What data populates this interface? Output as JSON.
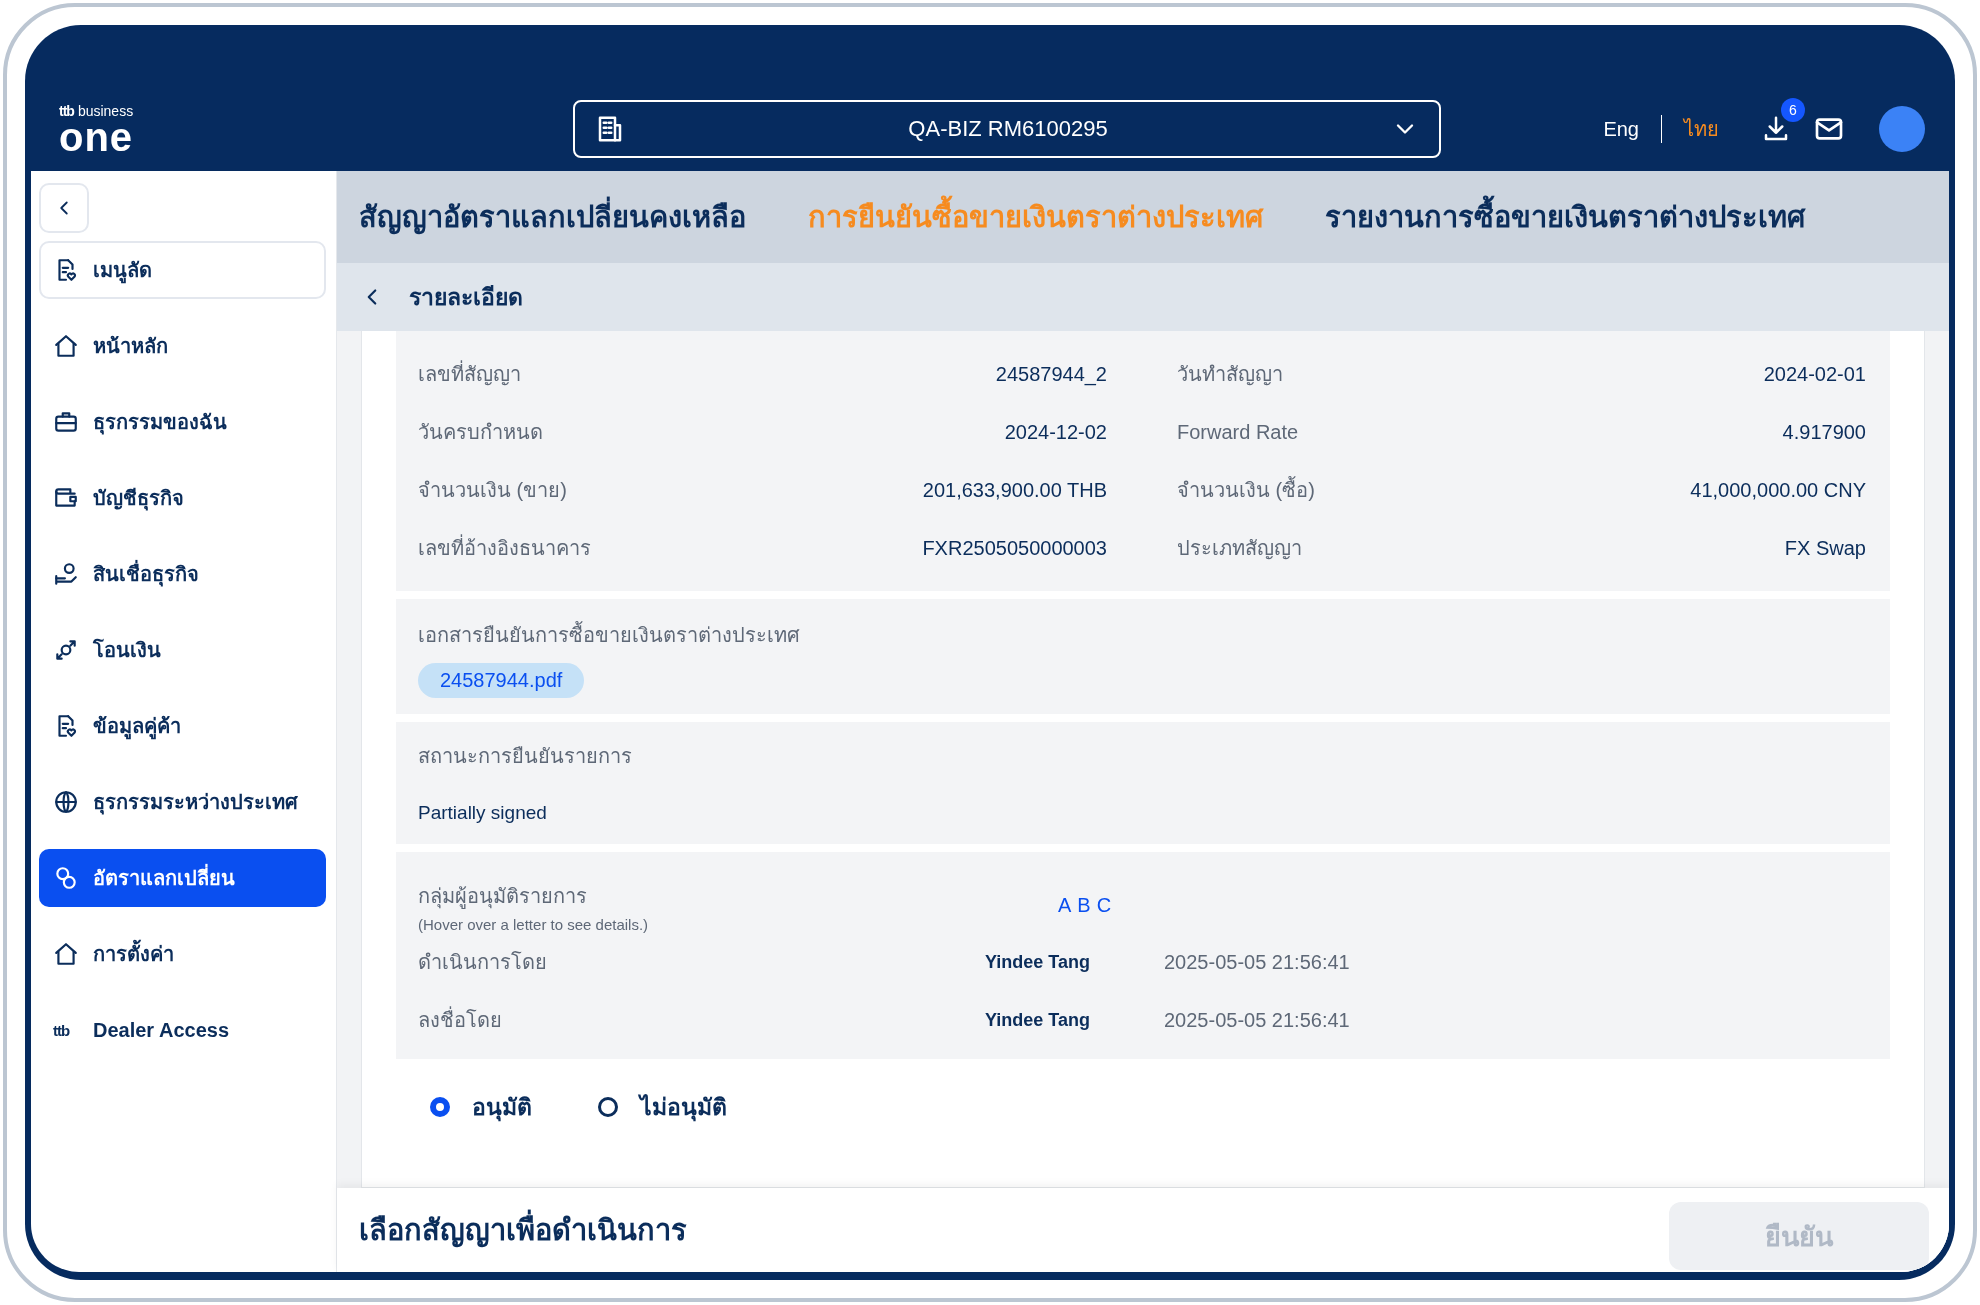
{
  "header": {
    "logo_small": "ttb",
    "logo_top": "business",
    "logo_main": "one",
    "account": "QA-BIZ RM6100295",
    "languages": [
      {
        "label": "Eng",
        "selected": false
      },
      {
        "label": "ไทย",
        "selected": true
      }
    ],
    "download_badge": "6"
  },
  "sidebar": {
    "items": [
      {
        "label": "เมนูลัด",
        "kind": "shortcut",
        "selected": false
      },
      {
        "label": "หน้าหลัก",
        "kind": "item",
        "selected": false
      },
      {
        "label": "ธุรกรรมของฉัน",
        "kind": "item",
        "selected": false
      },
      {
        "label": "บัญชีธุรกิจ",
        "kind": "item",
        "selected": false
      },
      {
        "label": "สินเชื่อธุรกิจ",
        "kind": "item",
        "selected": false
      },
      {
        "label": "โอนเงิน",
        "kind": "item",
        "selected": false
      },
      {
        "label": "ข้อมูลคู่ค้า",
        "kind": "item",
        "selected": false
      },
      {
        "label": "ธุรกรรมระหว่างประเทศ",
        "kind": "item",
        "selected": false
      },
      {
        "label": "อัตราแลกเปลี่ยน",
        "kind": "item",
        "selected": true
      },
      {
        "label": "การตั้งค่า",
        "kind": "item",
        "selected": false
      },
      {
        "label": "Dealer Access",
        "kind": "logo",
        "logo": "ttb",
        "selected": false
      }
    ]
  },
  "tabs": [
    {
      "label": "สัญญาอัตราแลกเปลี่ยนคงเหลือ",
      "selected": false
    },
    {
      "label": "การยืนยันซื้อขายเงินตราต่างประเทศ",
      "selected": true
    },
    {
      "label": "รายงานการซื้อขายเงินตราต่างประเทศ",
      "selected": false
    }
  ],
  "subheader": {
    "title": "รายละเอียด"
  },
  "details": [
    {
      "left_label": "เลขที่สัญญา",
      "left_value": "24587944_2",
      "right_label": "วันทำสัญญา",
      "right_value": "2024-02-01"
    },
    {
      "left_label": "วันครบกำหนด",
      "left_value": "2024-12-02",
      "right_label": "Forward Rate",
      "right_value": "4.917900"
    },
    {
      "left_label": "จำนวนเงิน (ขาย)",
      "left_value": "201,633,900.00 THB",
      "right_label": "จำนวนเงิน (ซื้อ)",
      "right_value": "41,000,000.00 CNY"
    },
    {
      "left_label": "เลขที่อ้างอิงธนาคาร",
      "left_value": "FXR2505050000003",
      "right_label": "ประเภทสัญญา",
      "right_value": "FX Swap"
    }
  ],
  "document": {
    "label": "เอกสารยืนยันการซื้อขายเงินตราต่างประเทศ",
    "file": "24587944.pdf"
  },
  "status": {
    "label": "สถานะการยืนยันรายการ",
    "value": "Partially signed"
  },
  "approvers": {
    "label": "กลุ่มผู้อนุมัติรายการ",
    "hint": "(Hover over a letter to see details.)",
    "letters": [
      "A",
      "B",
      "C"
    ],
    "rows": [
      {
        "label": "ดำเนินการโดย",
        "name": "Yindee Tang",
        "time": "2025-05-05 21:56:41"
      },
      {
        "label": "ลงชื่อโดย",
        "name": "Yindee Tang",
        "time": "2025-05-05 21:56:41"
      }
    ]
  },
  "decision": [
    {
      "label": "อนุมัติ",
      "selected": true
    },
    {
      "label": "ไม่อนุมัติ",
      "selected": false
    }
  ],
  "footer": {
    "title": "เลือกสัญญาเพื่อดำเนินการ",
    "confirm": {
      "label": "ยืนยัน",
      "disabled": true
    }
  }
}
